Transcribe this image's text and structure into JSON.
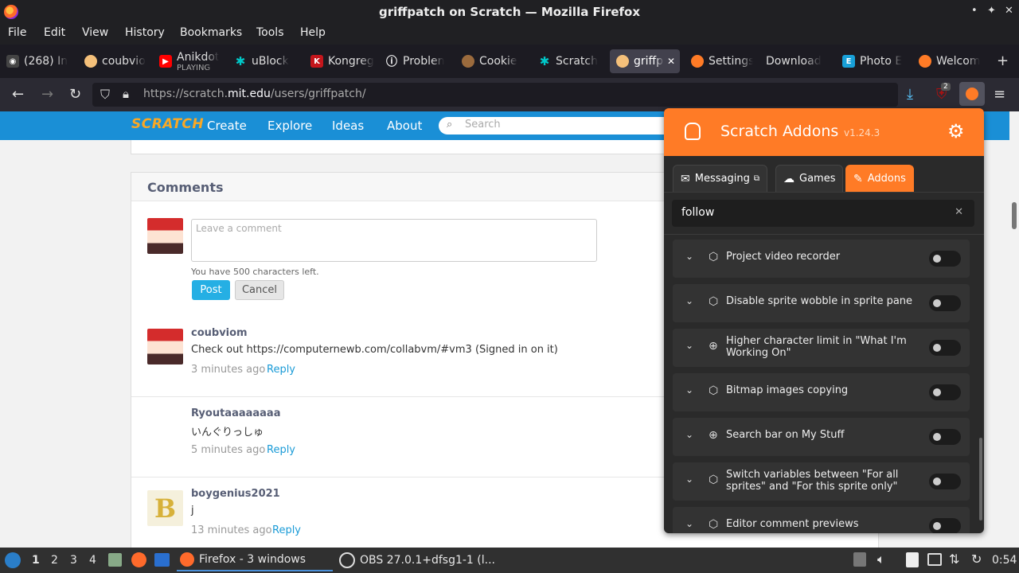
{
  "window": {
    "title": "griffpatch on Scratch — Mozilla Firefox",
    "controls": [
      "•",
      "✦",
      "✕"
    ]
  },
  "menu": [
    "File",
    "Edit",
    "View",
    "History",
    "Bookmarks",
    "Tools",
    "Help"
  ],
  "tabs": [
    {
      "label": "(268) In",
      "color": "#444444",
      "icon_text": "◉"
    },
    {
      "label": "coubvio",
      "color": "#f4c07a",
      "icon_text": ""
    },
    {
      "label": "Anikdot",
      "sub": "PLAYING",
      "color": "#ff0000",
      "icon_text": "▶"
    },
    {
      "label": "uBlock",
      "color": "#00b3b3",
      "icon_text": "✱"
    },
    {
      "label": "Kongreg",
      "color": "#c4161c",
      "icon_text": "K"
    },
    {
      "label": "Problen",
      "color": "#1c1b22",
      "icon_text": "ⓘ"
    },
    {
      "label": "Cookie",
      "color": "#9b6b3d",
      "icon_text": "●"
    },
    {
      "label": "Scratch",
      "color": "#00b3b3",
      "icon_text": "✱"
    },
    {
      "label": "griffpa",
      "color": "#f4c07a",
      "icon_text": ""
    },
    {
      "label": "Settings",
      "color": "#ff7b26",
      "icon_text": "●"
    },
    {
      "label": "Download",
      "color": "#1c1b22",
      "icon_text": ""
    },
    {
      "label": "Photo E",
      "color": "#18a0d8",
      "icon_text": "E"
    },
    {
      "label": "Welcom",
      "color": "#ff7b26",
      "icon_text": "●"
    }
  ],
  "nav": {
    "url_prefix": "https://scratch.",
    "url_domain": "mit.edu",
    "url_path": "/users/griffpatch/",
    "badge_count": "2"
  },
  "scratch": {
    "logo": "SCRATCH",
    "links": [
      "Create",
      "Explore",
      "Ideas",
      "About"
    ],
    "search_placeholder": "Search"
  },
  "comments": {
    "heading": "Comments",
    "placeholder": "Leave a comment",
    "chars_left": "You have 500 characters left.",
    "post": "Post",
    "cancel": "Cancel",
    "items": [
      {
        "author": "coubviom",
        "text": "Check out https://computernewb.com/collabvm/#vm3 (Signed in on it)",
        "time": "3 minutes ago",
        "reply": "Reply"
      },
      {
        "author": "Ryoutaaaaaaaa",
        "text": "いんぐりっしゅ",
        "time": "5 minutes ago",
        "reply": "Reply"
      },
      {
        "author": "boygenius2021",
        "text": "j",
        "time": "13 minutes ago",
        "reply": "Reply"
      }
    ]
  },
  "addons_popup": {
    "title": "Scratch Addons",
    "version": "v1.24.3",
    "tabs": [
      "Messaging",
      "Games",
      "Addons"
    ],
    "search_value": "follow",
    "addons": [
      {
        "name": "Project video recorder",
        "icon": "puzzle-icon",
        "enabled": false
      },
      {
        "name": "Disable sprite wobble in sprite pane",
        "icon": "puzzle-icon",
        "enabled": false
      },
      {
        "name": "Higher character limit in \"What I'm Working On\"",
        "icon": "globe-icon",
        "enabled": false
      },
      {
        "name": "Bitmap images copying",
        "icon": "puzzle-icon",
        "enabled": false
      },
      {
        "name": "Search bar on My Stuff",
        "icon": "globe-icon",
        "enabled": false
      },
      {
        "name": "Switch variables between \"For all sprites\" and \"For this sprite only\"",
        "icon": "puzzle-icon",
        "enabled": false
      },
      {
        "name": "Editor comment previews",
        "icon": "puzzle-icon",
        "enabled": false
      }
    ],
    "accent": "#ff7b26"
  },
  "taskbar": {
    "workspaces": [
      "1",
      "2",
      "3",
      "4"
    ],
    "firefox_task": "Firefox - 3 windows",
    "obs_task": "OBS 27.0.1+dfsg1-1 (l...",
    "clock": "0:54"
  }
}
